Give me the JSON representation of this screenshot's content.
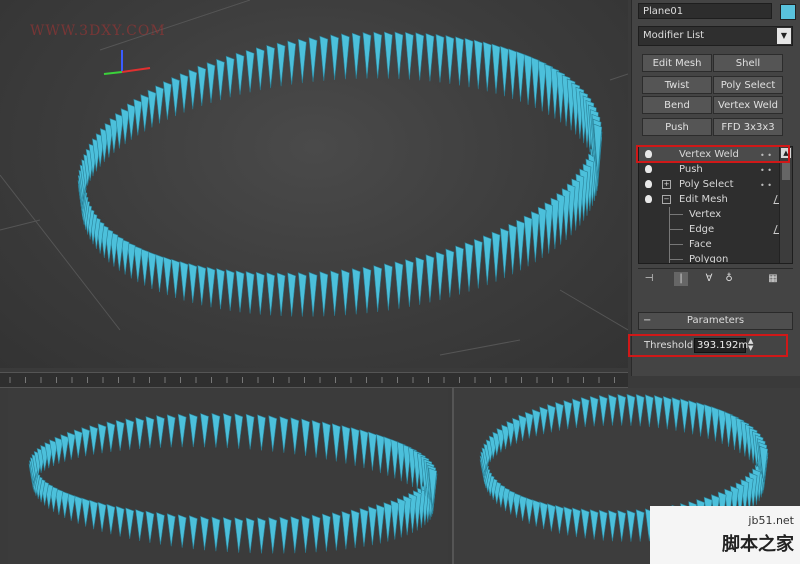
{
  "watermark": "WWW.3DXY.COM",
  "object_name": "Plane01",
  "object_color": "#59c3dd",
  "modifier_list": {
    "label": "Modifier List",
    "arrow": "▼"
  },
  "modifier_buttons": [
    "Edit Mesh",
    "Shell",
    "Twist",
    "Poly Select",
    "Bend",
    "Vertex Weld",
    "Push",
    "FFD 3x3x3"
  ],
  "stack": {
    "items": [
      {
        "label": "Vertex Weld",
        "type": "modifier",
        "selected": true
      },
      {
        "label": "Push",
        "type": "modifier"
      },
      {
        "label": "Poly Select",
        "type": "modifier",
        "expander": "+"
      },
      {
        "label": "Edit Mesh",
        "type": "modifier",
        "expander": "−"
      },
      {
        "label": "Vertex",
        "type": "sub"
      },
      {
        "label": "Edge",
        "type": "sub"
      },
      {
        "label": "Face",
        "type": "sub"
      },
      {
        "label": "Polygon",
        "type": "sub"
      }
    ]
  },
  "toolbar_icons": [
    "pin-stack-icon",
    "show-end-result-icon",
    "make-unique-icon",
    "remove-modifier-icon",
    "configure-modifier-sets-icon"
  ],
  "parameters": {
    "title": "Parameters",
    "collapse": "−",
    "threshold_label": "Threshold:",
    "threshold_value": "393.192m"
  },
  "logo": {
    "line1": "jb51.net",
    "line2": "脚本之家"
  },
  "colors": {
    "mesh": "#4cc0db",
    "highlight": "#d01818",
    "panel": "#444444"
  }
}
